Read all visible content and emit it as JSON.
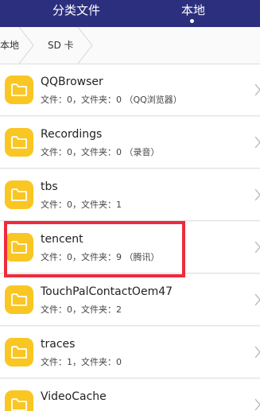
{
  "header": {
    "tabs": [
      {
        "label": "分类文件"
      },
      {
        "label": "本地"
      }
    ]
  },
  "breadcrumb": {
    "items": [
      {
        "label": "本地"
      },
      {
        "label": "SD 卡"
      }
    ]
  },
  "files": [
    {
      "name": "QQBrowser",
      "info": "文件：0，文件夹：0 （QQ浏览器）"
    },
    {
      "name": "Recordings",
      "info": "文件：0，文件夹：0 （录音）"
    },
    {
      "name": "tbs",
      "info": "文件：0，文件夹：1"
    },
    {
      "name": "tencent",
      "info": "文件：0，文件夹：9 （腾讯）"
    },
    {
      "name": "TouchPalContactOem47",
      "info": "文件：0，文件夹：2"
    },
    {
      "name": "traces",
      "info": "文件：1，文件夹：0"
    },
    {
      "name": "VideoCache",
      "info": ""
    }
  ],
  "colors": {
    "header_bg": "#2c2f7e",
    "folder_icon": "#f9c623",
    "highlight_border": "#ee2b3b"
  },
  "icons": {
    "folder": "folder-icon",
    "chevron": "chevron-right-icon"
  }
}
